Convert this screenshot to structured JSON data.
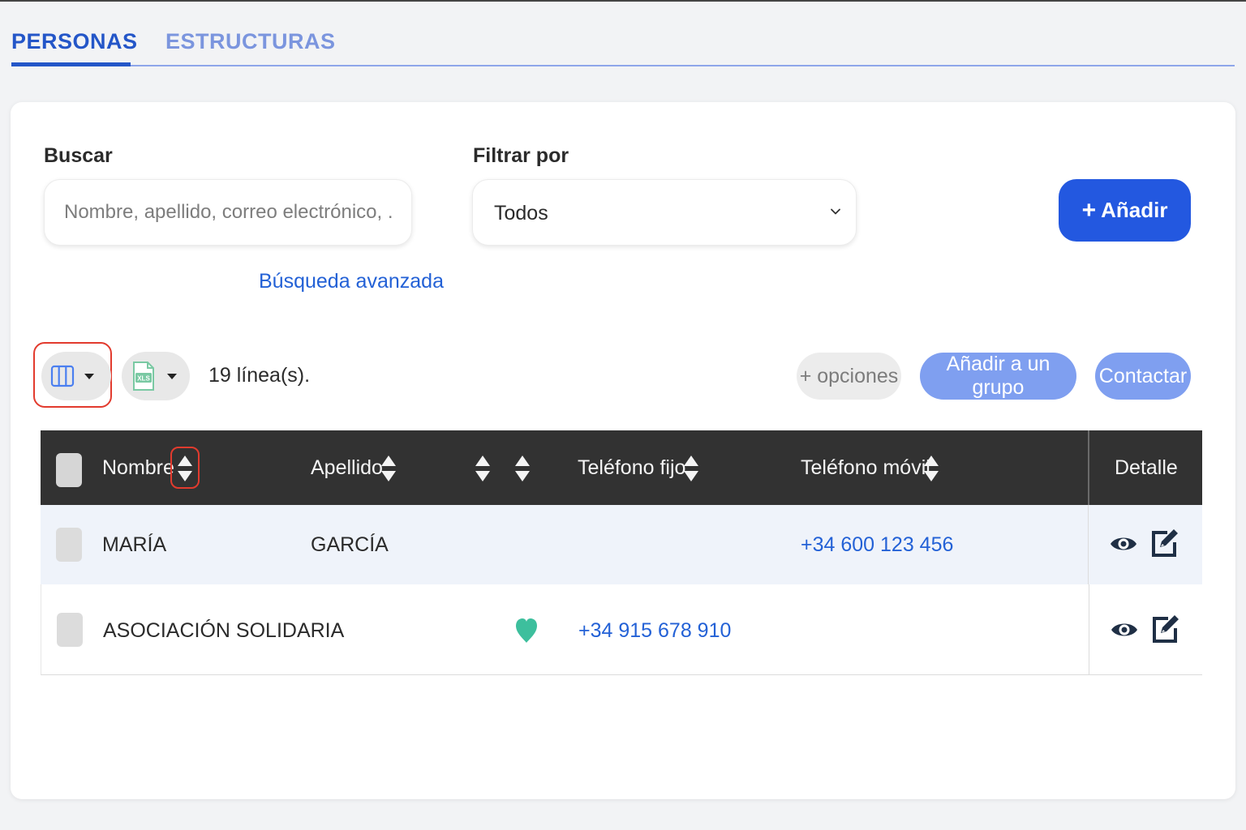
{
  "tabs": {
    "personas": "PERSONAS",
    "estructuras": "ESTRUCTURAS"
  },
  "search": {
    "label": "Buscar",
    "placeholder": "Nombre, apellido, correo electrónico, ...",
    "value": "",
    "advanced_link": "Búsqueda avanzada"
  },
  "filter": {
    "label": "Filtrar por",
    "selected": "Todos"
  },
  "add_button": {
    "plus": "+",
    "label": "Añadir"
  },
  "toolbar": {
    "columns_icon": "columns-icon",
    "export_icon": "xls-file-icon",
    "lines_count": "19 línea(s).",
    "more_options": "+ opciones",
    "add_to_group": "Añadir a un grupo",
    "contact": "Contactar"
  },
  "table": {
    "headers": {
      "nombre": "Nombre",
      "apellido": "Apellido",
      "telefono_fijo": "Teléfono fijo",
      "telefono_movil": "Teléfono móvil",
      "detalle": "Detalle"
    },
    "rows": [
      {
        "nombre": "MARÍA",
        "apellido": "GARCÍA",
        "favorite": false,
        "telefono_fijo": "",
        "telefono_movil": "+34 600 123 456"
      },
      {
        "nombre": "ASOCIACIÓN SOLIDARIA",
        "apellido": "",
        "favorite": true,
        "telefono_fijo": "+34 915 678 910",
        "telefono_movil": ""
      }
    ]
  },
  "colors": {
    "primary": "#2358e0",
    "tab_active": "#2456c8",
    "tab_inactive": "#7b95de",
    "link": "#2361d6",
    "pill_light": "#7f9ff0",
    "header_dark": "#323232",
    "highlight_outline": "#e23b2e",
    "favorite_heart": "#3dbf9d",
    "row_alt": "#eff3fa"
  }
}
